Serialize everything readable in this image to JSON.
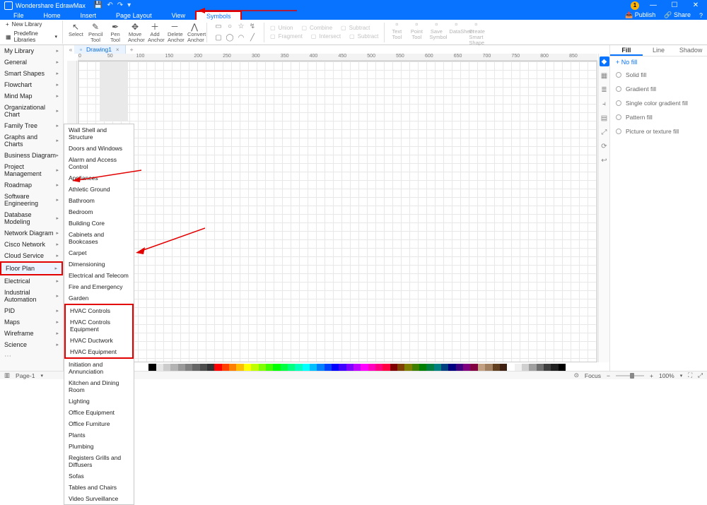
{
  "app": {
    "title": "Wondershare EdrawMax"
  },
  "titlebar": {
    "badge": "1",
    "publish": "Publish",
    "share": "Share"
  },
  "menubar": {
    "items": [
      "File",
      "Home",
      "Insert",
      "Page Layout",
      "View",
      "Symbols"
    ],
    "active_index": 5
  },
  "ribbon": {
    "new_library": "New Library",
    "predefine": "Predefine Libraries",
    "tools": [
      {
        "label": "Select",
        "icon": "↖"
      },
      {
        "label": "Pencil Tool",
        "icon": "✎"
      },
      {
        "label": "Pen Tool",
        "icon": "✒"
      },
      {
        "label": "Move Anchor",
        "icon": "✥"
      },
      {
        "label": "Add Anchor",
        "icon": "＋"
      },
      {
        "label": "Delete Anchor",
        "icon": "－"
      },
      {
        "label": "Convert Anchor",
        "icon": "⋀"
      }
    ],
    "disabled_ops": [
      [
        "Union",
        "Combine",
        "Subtract"
      ],
      [
        "Fragment",
        "Intersect",
        "Subtract"
      ]
    ],
    "right_tools": [
      "Text Tool",
      "Point Tool",
      "Save Symbol",
      "DataSheet",
      "Create Smart Shape"
    ]
  },
  "sidebar": {
    "categories": [
      "My Library",
      "General",
      "Smart Shapes",
      "Flowchart",
      "Mind Map",
      "Organizational Chart",
      "Family Tree",
      "Graphs and Charts",
      "Business Diagram",
      "Project Management",
      "Roadmap",
      "Software Engineering",
      "Database Modeling",
      "Network Diagram",
      "Cisco Network",
      "Cloud Service",
      "Floor Plan",
      "Electrical",
      "Industrial Automation",
      "PID",
      "Maps",
      "Wireframe",
      "Science"
    ],
    "highlight_index": 16
  },
  "flyout": {
    "items": [
      "Wall Shell and Structure",
      "Doors and Windows",
      "Alarm and Access Control",
      "Appliances",
      "Athletic Ground",
      "Bathroom",
      "Bedroom",
      "Building Core",
      "Cabinets and Bookcases",
      "Carpet",
      "Dimensioning",
      "Electrical and Telecom",
      "Fire and Emergency",
      "Garden",
      "HVAC Controls",
      "HVAC Controls Equipment",
      "HVAC Ductwork",
      "HVAC Equipment",
      "Initiation and Annunciation",
      "Kitchen and Dining Room",
      "Lighting",
      "Office Equipment",
      "Office Furniture",
      "Plants",
      "Plumbing",
      "Registers Grills and Diffusers",
      "Sofas",
      "Tables and Chairs",
      "Video Surveillance"
    ],
    "box_start": 14,
    "box_end": 17
  },
  "document": {
    "tab": "Drawing1"
  },
  "ruler": {
    "ticks": [
      "0",
      "50",
      "100",
      "150",
      "200",
      "250",
      "300",
      "350",
      "400",
      "450",
      "500",
      "550",
      "600",
      "650",
      "700",
      "750",
      "800",
      "850"
    ]
  },
  "rpanel": {
    "tabs": [
      "Fill",
      "Line",
      "Shadow"
    ],
    "active_tab": 0,
    "add": "+  No fill",
    "options": [
      "Solid fill",
      "Gradient fill",
      "Single color gradient fill",
      "Pattern fill",
      "Picture or texture fill"
    ]
  },
  "colorbar": [
    "#ffffff",
    "#000000",
    "#e6e6e6",
    "#cccccc",
    "#b3b3b3",
    "#999999",
    "#808080",
    "#666666",
    "#4d4d4d",
    "#333333",
    "#ff0000",
    "#ff4000",
    "#ff8000",
    "#ffbf00",
    "#ffff00",
    "#bfff00",
    "#80ff00",
    "#40ff00",
    "#00ff00",
    "#00ff40",
    "#00ff80",
    "#00ffbf",
    "#00ffff",
    "#00bfff",
    "#0080ff",
    "#0040ff",
    "#0000ff",
    "#4000ff",
    "#8000ff",
    "#bf00ff",
    "#ff00ff",
    "#ff00bf",
    "#ff0080",
    "#ff0040",
    "#800000",
    "#804000",
    "#808000",
    "#408000",
    "#008000",
    "#008040",
    "#008080",
    "#004080",
    "#000080",
    "#400080",
    "#800080",
    "#800040",
    "#c0a080",
    "#a08060",
    "#604020",
    "#402010",
    "#ffffff",
    "#f0f0f0",
    "#d0d0d0",
    "#a0a0a0",
    "#707070",
    "#404040",
    "#202020",
    "#000000"
  ],
  "statusbar": {
    "page": "Page-1",
    "focus": "Focus",
    "zoom": "100%"
  }
}
